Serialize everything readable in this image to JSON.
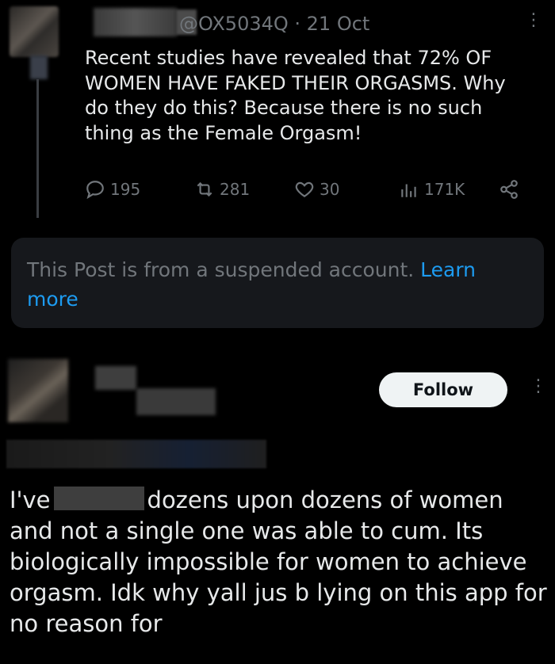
{
  "quoted_tweet": {
    "handle": "@OX5034Q · 21 Oct",
    "text": "Recent studies have revealed that 72% OF WOMEN HAVE FAKED THEIR ORGASMS. Why do they do this? Because there is no such thing as the Female Orgasm!",
    "replies": "195",
    "retweets": "281",
    "likes": "30",
    "views": "171K"
  },
  "suspended_notice": {
    "text": "This Post is from a suspended account.",
    "link": "Learn more"
  },
  "reply_tweet": {
    "follow_label": "Follow",
    "text_prefix": "I've",
    "text_rest": "dozens upon dozens of women and not a single one was able to cum. Its biologically impossible for women to achieve orgasm. Idk why yall jus b lying on this app for no reason for"
  },
  "colors": {
    "background": "#000000",
    "text": "#e7e9ea",
    "muted": "#71767b",
    "link": "#1d9bf0",
    "card": "#16181c"
  }
}
